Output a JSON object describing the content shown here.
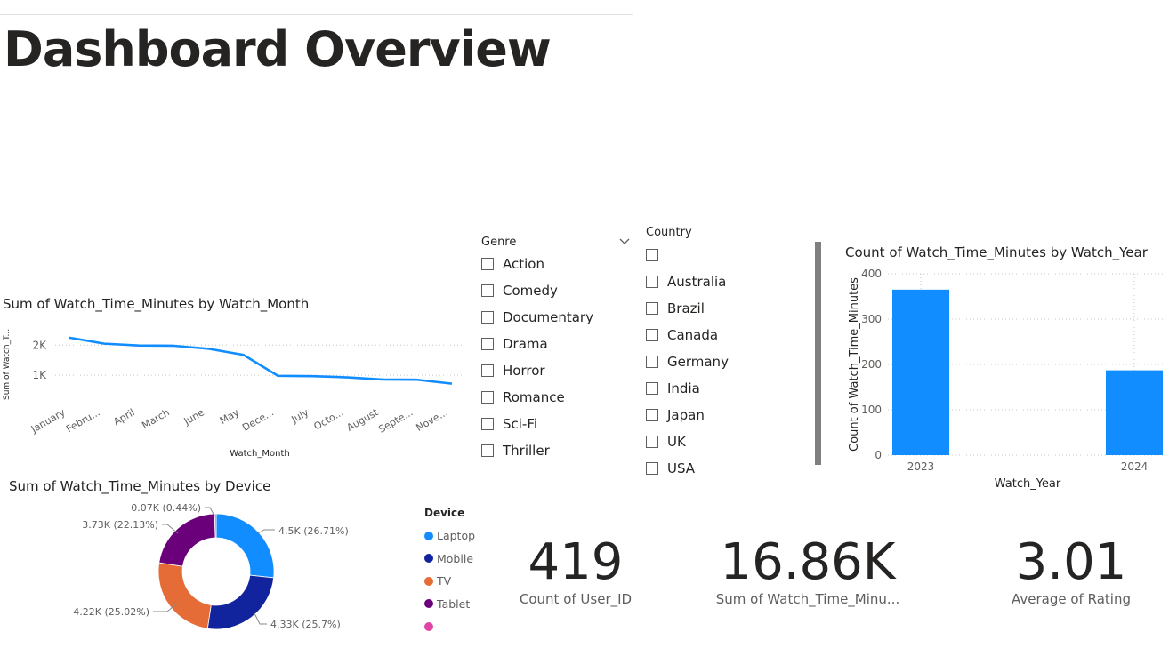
{
  "page": {
    "title": "Dashboard Overview"
  },
  "colors": {
    "accent": "#118dff",
    "text": "#252423",
    "muted": "#605e5c"
  },
  "genre_slicer": {
    "header": "Genre",
    "items": [
      "Action",
      "Comedy",
      "Documentary",
      "Drama",
      "Horror",
      "Romance",
      "Sci-Fi",
      "Thriller"
    ]
  },
  "country_slicer": {
    "header": "Country",
    "items": [
      "",
      "Australia",
      "Brazil",
      "Canada",
      "Germany",
      "India",
      "Japan",
      "UK",
      "USA"
    ]
  },
  "kpis": [
    {
      "value": "419",
      "label": "Count of User_ID"
    },
    {
      "value": "16.86K",
      "label": "Sum of Watch_Time_Minu..."
    },
    {
      "value": "3.01",
      "label": "Average of Rating"
    }
  ],
  "device_legend": {
    "title": "Device",
    "items": [
      {
        "label": "Laptop",
        "color": "#118dff"
      },
      {
        "label": "Mobile",
        "color": "#12239e"
      },
      {
        "label": "TV",
        "color": "#e66c37"
      },
      {
        "label": "Tablet",
        "color": "#6b007b"
      },
      {
        "label": "",
        "color": "#e044a7"
      }
    ]
  },
  "chart_data": [
    {
      "type": "line",
      "title": "Sum of Watch_Time_Minutes by Watch_Month",
      "xlabel": "Watch_Month",
      "ylabel": "Sum of Watch_T...",
      "categories": [
        "January",
        "Febru...",
        "April",
        "March",
        "June",
        "May",
        "Dece...",
        "July",
        "Octo...",
        "August",
        "Septe...",
        "Nove..."
      ],
      "values": [
        2250,
        2050,
        1990,
        1980,
        1880,
        1680,
        980,
        970,
        930,
        860,
        850,
        720
      ],
      "yticks": [
        "1K",
        "2K"
      ],
      "ylim": [
        0,
        2600
      ],
      "grid": true,
      "color": "#118dff"
    },
    {
      "type": "bar",
      "title": "Count of Watch_Time_Minutes by Watch_Year",
      "xlabel": "Watch_Year",
      "ylabel": "Count of Watch_Time_Minutes",
      "categories": [
        "2023",
        "2024"
      ],
      "values": [
        365,
        187
      ],
      "yticks": [
        "0",
        "100",
        "200",
        "300",
        "400"
      ],
      "ylim": [
        0,
        400
      ],
      "grid": true,
      "color": "#118dff"
    },
    {
      "type": "pie",
      "title": "Sum of Watch_Time_Minutes by Device",
      "donut": true,
      "categories": [
        "Laptop",
        "Mobile",
        "TV",
        "Tablet",
        ""
      ],
      "values": [
        4500,
        4330,
        4220,
        3730,
        70
      ],
      "data_labels": [
        "4.5K (26.71%)",
        "4.33K (25.7%)",
        "4.22K (25.02%)",
        "3.73K (22.13%)",
        "0.07K (0.44%)"
      ],
      "colors": [
        "#118dff",
        "#12239e",
        "#e66c37",
        "#6b007b",
        "#e044a7"
      ]
    }
  ]
}
